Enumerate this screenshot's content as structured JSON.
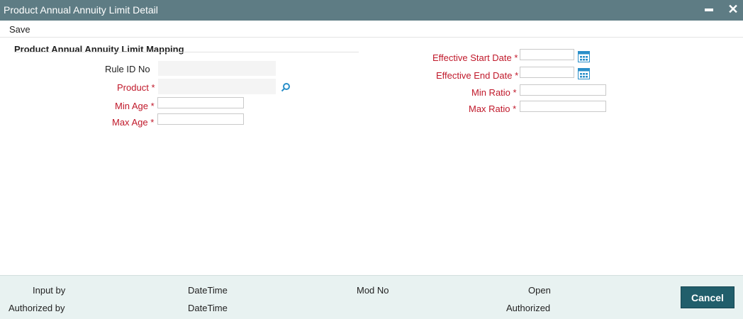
{
  "window": {
    "title": "Product Annual Annuity Limit Detail",
    "minimize_glyph": "—",
    "close_glyph": "✕"
  },
  "toolbar": {
    "save_label": "Save"
  },
  "section": {
    "title": "Product Annual Annuity Limit Mapping"
  },
  "form": {
    "rule_id": {
      "label": "Rule ID No",
      "value": ""
    },
    "product": {
      "label": "Product",
      "required_mark": "*",
      "value": "",
      "lookup_icon": "search-icon"
    },
    "min_age": {
      "label": "Min Age",
      "required_mark": "*",
      "value": ""
    },
    "max_age": {
      "label": "Max Age",
      "required_mark": "*",
      "value": ""
    },
    "effective_start_date": {
      "label": "Effective Start Date",
      "required_mark": "*",
      "value": "",
      "icon": "calendar-icon"
    },
    "effective_end_date": {
      "label": "Effective End Date",
      "required_mark": "*",
      "value": "",
      "icon": "calendar-icon"
    },
    "min_ratio": {
      "label": "Min Ratio",
      "required_mark": "*",
      "value": ""
    },
    "max_ratio": {
      "label": "Max Ratio",
      "required_mark": "*",
      "value": ""
    }
  },
  "footer": {
    "input_by": "Input by",
    "authorized_by": "Authorized by",
    "datetime_1": "DateTime",
    "datetime_2": "DateTime",
    "mod_no": "Mod No",
    "open": "Open",
    "authorized": "Authorized",
    "cancel_label": "Cancel"
  },
  "colors": {
    "titlebar": "#5e7c84",
    "required_label": "#c0182a",
    "footer_bg": "#e8f2f1",
    "cancel_bg": "#215e6b",
    "icon": "#2a8fc9"
  }
}
